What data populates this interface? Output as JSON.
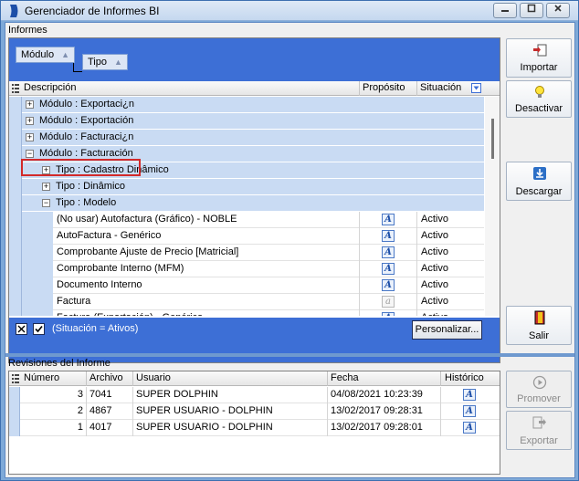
{
  "window": {
    "title": "Gerenciador de Informes BI"
  },
  "informes_label": "Informes",
  "group_by": [
    "Módulo",
    "Tipo"
  ],
  "columns": {
    "descripcion": "Descripción",
    "proposito": "Propósito",
    "situacion": "Situación"
  },
  "rows": [
    {
      "kind": "group",
      "level": 0,
      "expander": "+",
      "label": "Módulo : Exportaci¿n"
    },
    {
      "kind": "group",
      "level": 0,
      "expander": "+",
      "label": "Módulo : Exportación"
    },
    {
      "kind": "group",
      "level": 0,
      "expander": "+",
      "label": "Módulo : Facturaci¿n"
    },
    {
      "kind": "group",
      "level": 0,
      "expander": "−",
      "label": "Módulo : Facturación"
    },
    {
      "kind": "group",
      "level": 1,
      "expander": "+",
      "label": "Tipo : Cadastro Dinâmico"
    },
    {
      "kind": "group",
      "level": 1,
      "expander": "+",
      "label": "Tipo : Dinâmico"
    },
    {
      "kind": "group",
      "level": 1,
      "expander": "−",
      "label": "Tipo : Modelo"
    },
    {
      "kind": "item",
      "label": "(No usar) Autofactura (Gráfico) - NOBLE",
      "proposito_icon": "report-icon",
      "situacion": "Activo"
    },
    {
      "kind": "item",
      "label": "AutoFactura - Genérico",
      "proposito_icon": "report-icon",
      "situacion": "Activo"
    },
    {
      "kind": "item",
      "label": "Comprobante Ajuste de Precio [Matricial]",
      "proposito_icon": "report-icon",
      "situacion": "Activo"
    },
    {
      "kind": "item",
      "label": "Comprobante Interno (MFM)",
      "proposito_icon": "report-icon",
      "situacion": "Activo"
    },
    {
      "kind": "item",
      "label": "Documento Interno",
      "proposito_icon": "report-icon",
      "situacion": "Activo"
    },
    {
      "kind": "item",
      "label": "Factura",
      "proposito_icon": "report-gray-icon",
      "situacion": "Activo"
    },
    {
      "kind": "item",
      "label": "Factura (Exportación) - Genérico",
      "proposito_icon": "report-icon",
      "situacion": "Activo"
    }
  ],
  "filter": {
    "text": "(Situación = Ativos)",
    "personalizar": "Personalizar..."
  },
  "buttons": {
    "importar": "Importar",
    "desactivar": "Desactivar",
    "descargar": "Descargar",
    "salir": "Salir",
    "promover": "Promover",
    "exportar": "Exportar"
  },
  "revisiones_label": "Revisiones del Informe",
  "rev_columns": {
    "numero": "Número",
    "archivo": "Archivo",
    "usuario": "Usuario",
    "fecha": "Fecha",
    "historico": "Histórico"
  },
  "revisiones": [
    {
      "numero": "3",
      "archivo": "7041",
      "usuario": "SUPER DOLPHIN",
      "fecha": "04/08/2021 10:23:39"
    },
    {
      "numero": "2",
      "archivo": "4867",
      "usuario": "SUPER USUARIO - DOLPHIN",
      "fecha": "13/02/2017 09:28:31"
    },
    {
      "numero": "1",
      "archivo": "4017",
      "usuario": "SUPER USUARIO - DOLPHIN",
      "fecha": "13/02/2017 09:28:01"
    }
  ],
  "colors": {
    "group_bar": "#3d6fd6",
    "group_row": "#c9dbf3",
    "highlight": "#d32a2a"
  }
}
